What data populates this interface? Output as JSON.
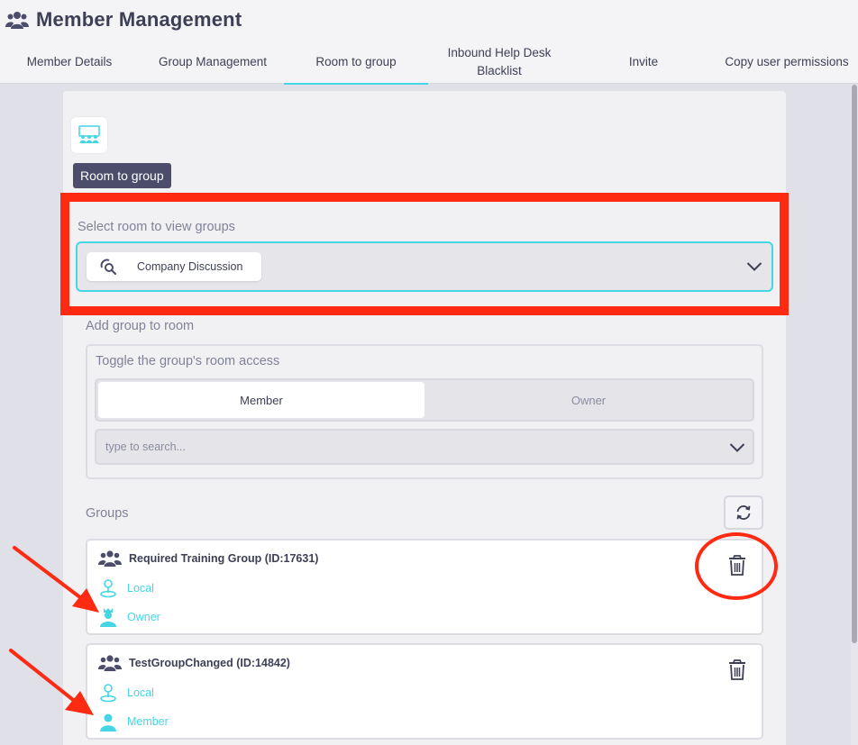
{
  "header": {
    "title": "Member Management",
    "title_icon": "people-icon"
  },
  "tabs": [
    {
      "label": "Member Details",
      "active": false
    },
    {
      "label": "Group Management",
      "active": false
    },
    {
      "label": "Room to group",
      "active": true
    },
    {
      "label": "Inbound Help Desk Blacklist",
      "active": false
    },
    {
      "label": "Invite",
      "active": false
    },
    {
      "label": "Copy user permissions",
      "active": false
    }
  ],
  "section": {
    "icon": "conference-room-icon",
    "badge": "Room to group"
  },
  "room_select": {
    "label": "Select room to view groups",
    "selected": "Company Discussion",
    "chip_icon": "room-search-icon"
  },
  "add_group": {
    "label": "Add group to room",
    "toggle_label": "Toggle the group's room access",
    "options": [
      "Member",
      "Owner"
    ],
    "selected": "Member",
    "search_placeholder": "type to search..."
  },
  "groups": {
    "label": "Groups",
    "items": [
      {
        "name": "Required Training Group (ID:17631)",
        "scope": "Local",
        "role": "Owner"
      },
      {
        "name": "TestGroupChanged (ID:14842)",
        "scope": "Local",
        "role": "Member"
      }
    ]
  },
  "colors": {
    "accent": "#45d6e6",
    "text": "#3d3f55",
    "muted": "#808297",
    "annotation": "#ff2a12"
  }
}
